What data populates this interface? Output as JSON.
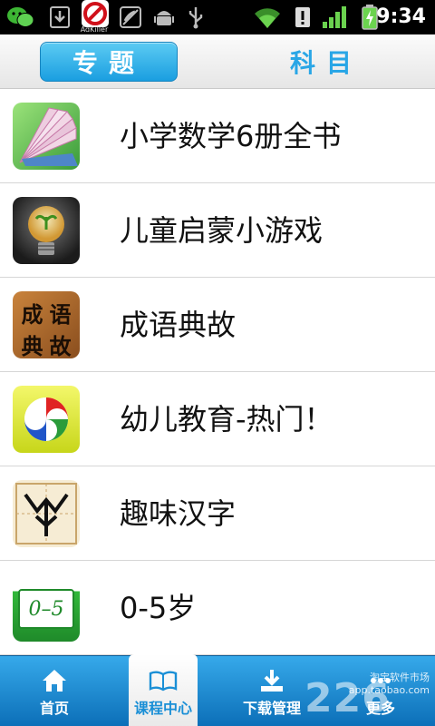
{
  "status_bar": {
    "time": "9:34",
    "adkiller_label": "AdKiller",
    "icons": [
      "wechat-icon",
      "download-icon",
      "adkiller-icon",
      "phone-slash-icon",
      "android-icon",
      "usb-icon",
      "wifi-icon",
      "alert-icon",
      "signal-icon",
      "battery-icon"
    ]
  },
  "tabs": {
    "left_label": "专题",
    "right_label": "科目",
    "active": "专题"
  },
  "list": [
    {
      "label": "小学数学6册全书",
      "icon": "math-book-icon"
    },
    {
      "label": "儿童启蒙小游戏",
      "icon": "lightbulb-icon"
    },
    {
      "label": "成语典故",
      "icon": "idiom-icon",
      "icon_text": [
        "成",
        "语",
        "典",
        "故"
      ]
    },
    {
      "label": "幼儿教育-热门！",
      "icon": "kids-education-icon"
    },
    {
      "label": "趣味汉字",
      "icon": "chinese-character-icon"
    },
    {
      "label": "0-5岁",
      "icon": "age-0-5-icon",
      "icon_text": "0–5"
    }
  ],
  "bottom_nav": {
    "items": [
      {
        "label": "首页",
        "icon": "home-icon"
      },
      {
        "label": "课程中心",
        "icon": "book-icon",
        "active": true
      },
      {
        "label": "下载管理",
        "icon": "download-icon"
      },
      {
        "label": "更多",
        "icon": "more-icon"
      }
    ]
  },
  "watermark": {
    "line1": "淘宝软件市场",
    "line2": "app.taobao.com",
    "logo": "226"
  },
  "colors": {
    "accent": "#1a9ee0",
    "nav_bg": "#1a8fd6",
    "status_bg": "#000000"
  }
}
